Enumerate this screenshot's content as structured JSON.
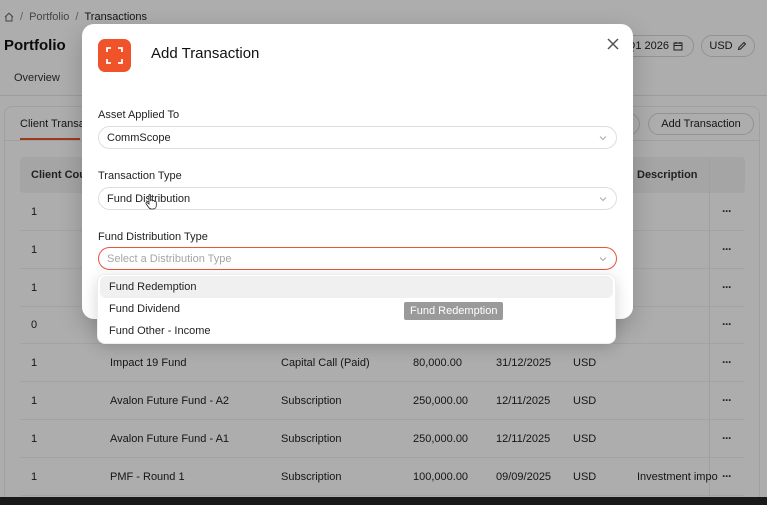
{
  "breadcrumb": {
    "items": [
      "Portfolio",
      "Transactions"
    ],
    "separator": "/"
  },
  "page": {
    "title": "Portfolio",
    "period": "Q1 2026",
    "currency": "USD"
  },
  "tabs": {
    "overview": "Overview"
  },
  "subtabs": {
    "client": "Client Transac",
    "add_button": "Add Transaction"
  },
  "table": {
    "headers": {
      "client_count": "Client Cour",
      "description": "Description"
    },
    "rows": [
      {
        "count": "1",
        "fund": "",
        "type": "",
        "amount": "",
        "date": "",
        "currency": "",
        "description": ""
      },
      {
        "count": "1",
        "fund": "",
        "type": "",
        "amount": "",
        "date": "",
        "currency": "",
        "description": ""
      },
      {
        "count": "1",
        "fund": "",
        "type": "",
        "amount": "",
        "date": "",
        "currency": "",
        "description": ""
      },
      {
        "count": "0",
        "fund": "",
        "type": "",
        "amount": "",
        "date": "",
        "currency": "",
        "description": ""
      },
      {
        "count": "1",
        "fund": "Impact 19 Fund",
        "type": "Capital Call (Paid)",
        "amount": "80,000.00",
        "date": "31/12/2025",
        "currency": "USD",
        "description": ""
      },
      {
        "count": "1",
        "fund": "Avalon Future Fund - A2",
        "type": "Subscription",
        "amount": "250,000.00",
        "date": "12/11/2025",
        "currency": "USD",
        "description": ""
      },
      {
        "count": "1",
        "fund": "Avalon Future Fund - A1",
        "type": "Subscription",
        "amount": "250,000.00",
        "date": "12/11/2025",
        "currency": "USD",
        "description": ""
      },
      {
        "count": "1",
        "fund": "PMF - Round 1",
        "type": "Subscription",
        "amount": "100,000.00",
        "date": "09/09/2025",
        "currency": "USD",
        "description": "Investment impo"
      }
    ],
    "row_menu": "···"
  },
  "modal": {
    "title": "Add Transaction",
    "asset_label": "Asset Applied To",
    "asset_value": "CommScope",
    "type_label": "Transaction Type",
    "type_value": "Fund Distribution",
    "dist_label": "Fund Distribution Type",
    "dist_placeholder": "Select a Distribution Type",
    "options": [
      "Fund Redemption",
      "Fund Dividend",
      "Fund Other - Income"
    ],
    "tooltip": "Fund Redemption"
  },
  "colors": {
    "accent": "#f0522a",
    "error_border": "#e8553a"
  }
}
